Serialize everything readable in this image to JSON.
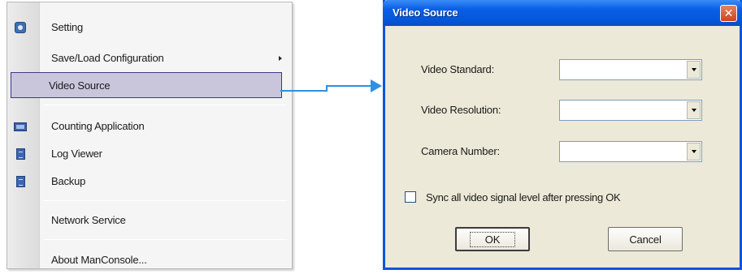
{
  "context_menu": {
    "items": [
      {
        "label": "Setting",
        "icon": "gear-icon",
        "has_submenu": false
      },
      {
        "label": "Save/Load Configuration",
        "icon": null,
        "has_submenu": true
      },
      {
        "label": "Video Source",
        "icon": null,
        "has_submenu": false,
        "selected": true
      },
      {
        "label": "Counting Application",
        "icon": "counter-icon",
        "has_submenu": false
      },
      {
        "label": "Log Viewer",
        "icon": "document-icon",
        "has_submenu": false
      },
      {
        "label": "Backup",
        "icon": "document-icon",
        "has_submenu": false
      },
      {
        "label": "Network Service",
        "icon": null,
        "has_submenu": false
      },
      {
        "label": "About ManConsole...",
        "icon": null,
        "has_submenu": false
      }
    ],
    "selection_color": "#c9c6dc"
  },
  "arrow_color": "#2f8fe0",
  "dialog": {
    "title": "Video Source",
    "title_bar_color": "#0a5fe6",
    "fields": [
      {
        "label": "Video Standard:",
        "value": ""
      },
      {
        "label": "Video Resolution:",
        "value": ""
      },
      {
        "label": "Camera Number:",
        "value": ""
      }
    ],
    "checkbox": {
      "label": "Sync all video signal level after pressing OK",
      "checked": false
    },
    "ok_label": "OK",
    "cancel_label": "Cancel"
  }
}
